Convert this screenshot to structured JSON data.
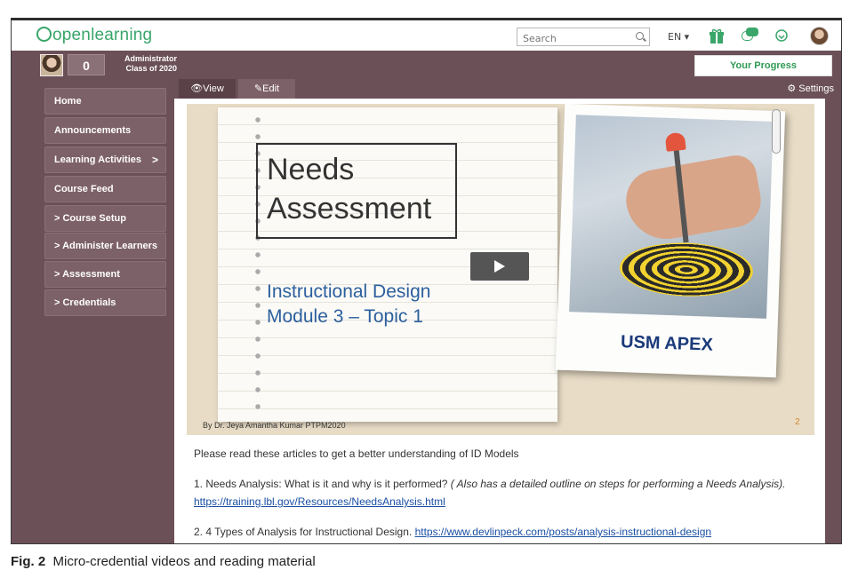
{
  "topbar": {
    "logo": "openlearning",
    "search_placeholder": "Search",
    "language": "EN ▾"
  },
  "user": {
    "points": "0",
    "role": "Administrator",
    "class": "Class of 2020",
    "progress_button": "Your Progress"
  },
  "sidebar": {
    "items": [
      {
        "label": "Home"
      },
      {
        "label": "Announcements"
      },
      {
        "label": "Learning Activities",
        "chevron": ">"
      },
      {
        "label": "Course Feed"
      },
      {
        "label": "> Course Setup"
      },
      {
        "label": "> Administer Learners"
      },
      {
        "label": "> Assessment"
      },
      {
        "label": "> Credentials"
      }
    ]
  },
  "main": {
    "tabs": {
      "view": "👁View",
      "edit": "✎Edit"
    },
    "settings": "⚙ Settings"
  },
  "video": {
    "title_line1": "Needs",
    "title_line2": "Assessment",
    "subtitle_line1": "Instructional Design",
    "subtitle_line2": "Module 3 – Topic 1",
    "logos": "USM APEX",
    "byline": "By Dr. Jeya Amantha Kumar PTPM2020",
    "slide_number": "2"
  },
  "reading": {
    "intro": "Please read these articles to get a better understanding of ID Models",
    "item1_prefix": "1. Needs Analysis: What is it and why is it performed? ",
    "item1_note": "( Also has a detailed outline on steps for performing a Needs Analysis).",
    "item1_link": "https://training.lbl.gov/Resources/NeedsAnalysis.html",
    "item2_prefix": "2. 4 Types of Analysis for Instructional Design.  ",
    "item2_link": "https://www.devlinpeck.com/posts/analysis-instructional-design"
  },
  "caption": {
    "label": "Fig. 2",
    "text": "Micro-credential videos and reading material"
  },
  "colors": {
    "brand_green": "#3aa66a",
    "panel_mauve": "#6b5058",
    "link_blue": "#1a4fa3"
  }
}
